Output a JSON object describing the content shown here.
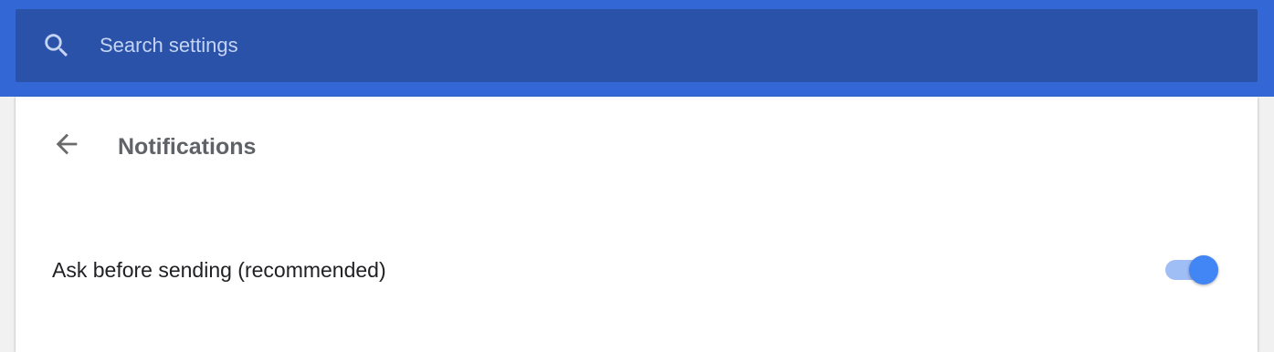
{
  "search": {
    "placeholder": "Search settings",
    "value": ""
  },
  "page": {
    "title": "Notifications",
    "back_icon": "arrow-back-icon"
  },
  "settings": [
    {
      "label": "Ask before sending (recommended)",
      "enabled": true
    }
  ],
  "colors": {
    "header": "#3367d6",
    "search_box": "#2a52a9",
    "toggle_on": "#4285f4",
    "toggle_track_on": "#9fbef5"
  }
}
